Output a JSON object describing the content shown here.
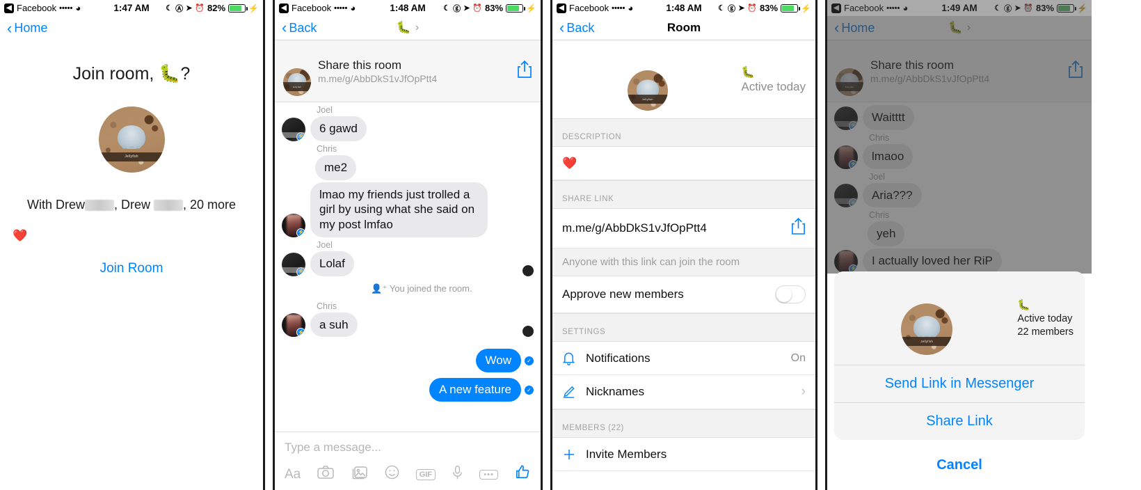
{
  "panels": {
    "p1": {
      "status": {
        "badge": "◀",
        "carrier": "Facebook",
        "signal": "•••••",
        "wifi": "ᴗ",
        "time": "1:47 AM",
        "moon": "☾",
        "lock": "Ⓐ",
        "loc": "➤",
        "alarm": "⏰",
        "battery_pct": "82%",
        "charging": "⚡"
      },
      "nav": {
        "back_label": "Home"
      },
      "title": "Join room, 🐛?",
      "avatar_caption": "Jellyfish",
      "with_prefix": "With Drew",
      "with_mid": ", Drew",
      "with_suffix": ", 20 more",
      "reaction": "❤️",
      "join_button": "Join Room"
    },
    "p2": {
      "status": {
        "badge": "◀",
        "carrier": "Facebook",
        "signal": "•••••",
        "wifi": "ᴗ",
        "time": "1:48 AM",
        "battery_pct": "83%",
        "charging": "⚡"
      },
      "nav": {
        "back_label": "Back",
        "room_emoji": "🐛",
        "chevron": "›"
      },
      "share": {
        "title": "Share this room",
        "link": "m.me/g/AbbDkS1vJfOpPtt4",
        "icon": "share-icon"
      },
      "messages": [
        {
          "sender": "Joel",
          "avatar": "joel",
          "text": "6 gawd",
          "side": "in"
        },
        {
          "sender": "Chris",
          "avatar": "chris",
          "text": "me2",
          "side": "in"
        },
        {
          "sender": "",
          "avatar": "chris",
          "text": "lmao my friends just trolled a girl by using what she said on my post lmfao",
          "side": "in"
        },
        {
          "sender": "Joel",
          "avatar": "joel",
          "text": "Lolaf",
          "side": "in"
        }
      ],
      "system_line": "You joined the room.",
      "system_icon": "👤⁺",
      "messages2": [
        {
          "sender": "Chris",
          "avatar": "chris",
          "text": "a suh",
          "side": "in"
        }
      ],
      "outgoing": [
        {
          "text": "Wow"
        },
        {
          "text": "A new feature"
        }
      ],
      "composer": {
        "placeholder": "Type a message...",
        "icons": [
          "Aa",
          "camera-icon",
          "gallery-icon",
          "emoji-icon",
          "GIF",
          "mic-icon",
          "more-icon",
          "thumbs-up-icon"
        ]
      }
    },
    "p3": {
      "status": {
        "badge": "◀",
        "carrier": "Facebook",
        "signal": "•••••",
        "wifi": "ᴗ",
        "time": "1:48 AM",
        "battery_pct": "83%",
        "charging": "⚡"
      },
      "nav": {
        "back_label": "Back",
        "title": "Room"
      },
      "header": {
        "emoji": "🐛",
        "active": "Active today"
      },
      "sections": [
        {
          "label": "DESCRIPTION"
        },
        {
          "label": "SHARE LINK"
        },
        {
          "label": "SETTINGS"
        },
        {
          "label": "MEMBERS (22)"
        }
      ],
      "description_value": "❤️",
      "share_link": "m.me/g/AbbDkS1vJfOpPtt4",
      "share_note": "Anyone with this link can join the room",
      "approve_label": "Approve new members",
      "approve_state": "off",
      "settings": [
        {
          "label": "Notifications",
          "icon": "bell-icon",
          "value": "On",
          "chevron": ""
        },
        {
          "label": "Nicknames",
          "icon": "pencil-icon",
          "value": "",
          "chevron": "›"
        }
      ],
      "invite_label": "Invite Members",
      "invite_icon": "plus-icon"
    },
    "p4": {
      "status": {
        "badge": "◀",
        "carrier": "Facebook",
        "signal": "•••••",
        "wifi": "ᴗ",
        "time": "1:49 AM",
        "battery_pct": "83%",
        "charging": "⚡"
      },
      "nav": {
        "back_label": "Home",
        "room_emoji": "🐛",
        "chevron": "›"
      },
      "share": {
        "title": "Share this room",
        "link": "m.me/g/AbbDkS1vJfOpPtt4"
      },
      "messages": [
        {
          "sender": "",
          "avatar": "joel",
          "text": "Waitttt"
        },
        {
          "sender": "Chris",
          "avatar": "chris",
          "text": "lmaoo"
        },
        {
          "sender": "Joel",
          "avatar": "joel",
          "text": "Aria???"
        },
        {
          "sender": "Chris",
          "avatar": "chris",
          "text": "yeh"
        },
        {
          "sender": "",
          "avatar": "chris",
          "text": "I actually loved her RiP"
        }
      ],
      "sheet": {
        "emoji": "🐛",
        "active": "Active today",
        "members": "22 members",
        "send_link": "Send Link in Messenger",
        "share_link": "Share Link",
        "cancel": "Cancel"
      }
    }
  },
  "colors": {
    "accent": "#0084ff",
    "bubble_in": "#e9e9eb",
    "battery_green": "#4cd964",
    "muted": "#9b9b9b"
  }
}
